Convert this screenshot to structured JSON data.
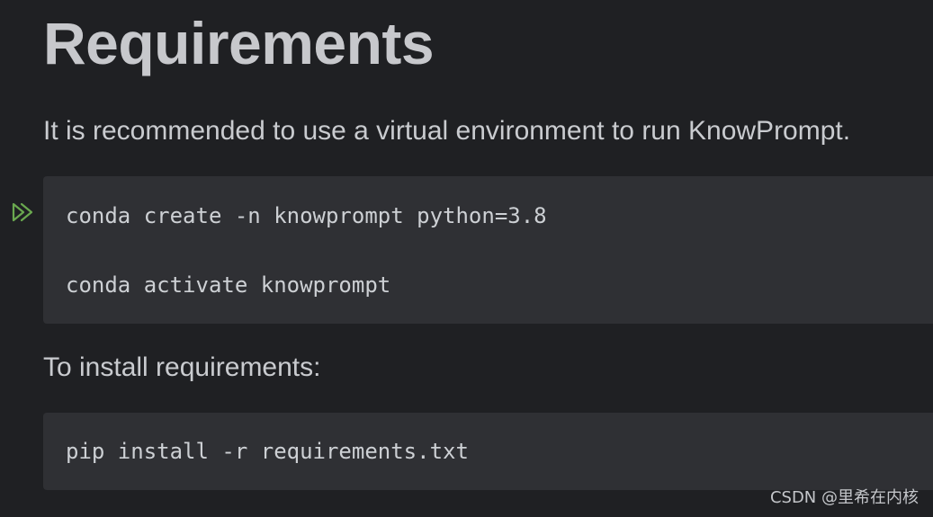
{
  "document": {
    "heading": "Requirements",
    "intro": "It is recommended to use a virtual environment to run KnowPrompt.",
    "code_block_1": {
      "lines": [
        "conda create -n knowprompt python=3.8",
        "conda activate knowprompt"
      ]
    },
    "install_text": "To install requirements:",
    "code_block_2": {
      "lines": [
        "pip install -r requirements.txt"
      ]
    }
  },
  "icons": {
    "run_icon": "run-double-chevron-icon",
    "run_icon_color": "#6aa84f"
  },
  "colors": {
    "background": "#1f2023",
    "code_background": "#2f3034",
    "text": "#c9cbcf"
  },
  "watermark": "CSDN @里希在内核"
}
